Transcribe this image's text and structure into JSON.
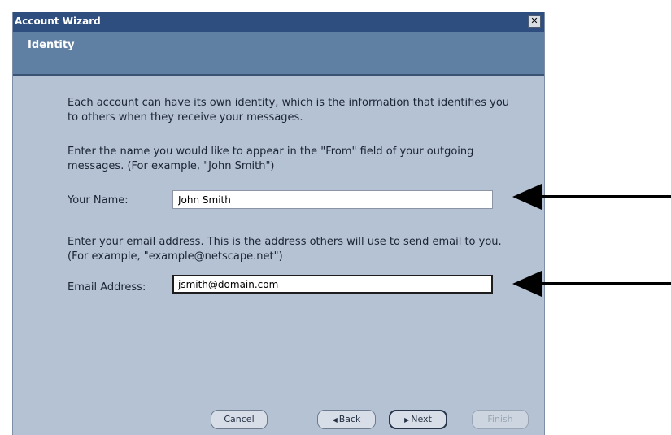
{
  "window": {
    "title": "Account Wizard",
    "close_glyph": "✕"
  },
  "header": {
    "heading": "Identity"
  },
  "content": {
    "intro": "Each account can have its own identity, which is the information that identifies you to others when they receive your messages.",
    "name_instructions": "Enter the name you would like to appear in the \"From\" field of your outgoing messages. (For example, \"John Smith\")",
    "name_label": "Your Name:",
    "name_value": "John Smith",
    "email_instructions": "Enter your email address. This is the address others will use to send email to you. (For example, \"example@netscape.net\")",
    "email_label": "Email Address:",
    "email_value": "jsmith@domain.com"
  },
  "buttons": {
    "cancel": "Cancel",
    "back": "Back",
    "next": "Next",
    "finish": "Finish",
    "back_arrow": "◀",
    "next_arrow": "▶"
  },
  "colors": {
    "titlebar": "#2e4e80",
    "header": "#5f7fa3",
    "dialog_bg": "#b5c2d3"
  }
}
